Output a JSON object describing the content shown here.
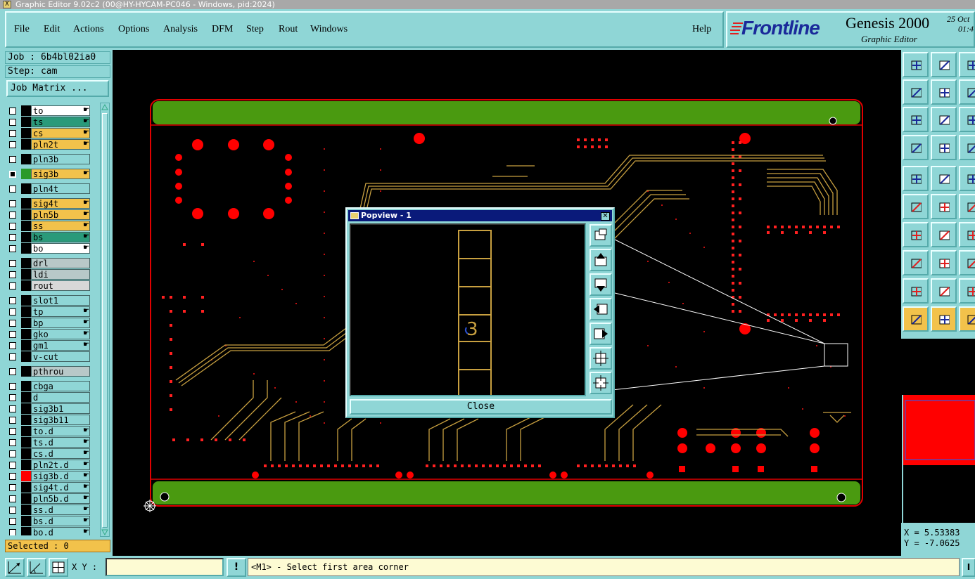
{
  "window": {
    "title": "Graphic Editor 9.02c2 (00@HY-HYCAM-PC046 - Windows, pid:2024)"
  },
  "menu": {
    "file": "File",
    "edit": "Edit",
    "actions": "Actions",
    "options": "Options",
    "analysis": "Analysis",
    "dfm": "DFM",
    "step": "Step",
    "rout": "Rout",
    "windows": "Windows",
    "help": "Help"
  },
  "brand": {
    "logo": "Frontline",
    "product": "Genesis 2000",
    "subtitle": "Graphic Editor",
    "date_line1": "25 Oct",
    "date_line2": "01:4"
  },
  "job": {
    "job_label": "Job : 6b4bl02ia0",
    "step_label": "Step: cam",
    "matrix_button": "Job Matrix ..."
  },
  "layers": [
    {
      "name": "to",
      "color": "#ffffff",
      "swatch": "#000000",
      "hand": true
    },
    {
      "name": "ts",
      "color": "#2a9a7a",
      "swatch": "#000000",
      "hand": true
    },
    {
      "name": "cs",
      "color": "#f2c24b",
      "swatch": "#000000",
      "hand": true
    },
    {
      "name": "pln2t",
      "color": "#f2c24b",
      "swatch": "#000000",
      "hand": true
    },
    {
      "name": "pln3b",
      "color": "#8fd6d6",
      "swatch": "#000000",
      "hand": false
    },
    {
      "name": "sig3b",
      "color": "#f2c24b",
      "swatch": "#2a9a2a",
      "hand": true,
      "active": true
    },
    {
      "name": "pln4t",
      "color": "#8fd6d6",
      "swatch": "#000000",
      "hand": false
    },
    {
      "name": "sig4t",
      "color": "#f2c24b",
      "swatch": "#000000",
      "hand": true
    },
    {
      "name": "pln5b",
      "color": "#f2c24b",
      "swatch": "#000000",
      "hand": true
    },
    {
      "name": "ss",
      "color": "#f2c24b",
      "swatch": "#000000",
      "hand": true
    },
    {
      "name": "bs",
      "color": "#2a9a7a",
      "swatch": "#000000",
      "hand": true
    },
    {
      "name": "bo",
      "color": "#ffffff",
      "swatch": "#000000",
      "hand": true
    },
    {
      "name": "drl",
      "color": "#b8c8c8",
      "swatch": "#000000",
      "hand": false
    },
    {
      "name": "ldi",
      "color": "#b8c8c8",
      "swatch": "#000000",
      "hand": false
    },
    {
      "name": "rout",
      "color": "#d8d8d8",
      "swatch": "#000000",
      "hand": false
    },
    {
      "name": "slot1",
      "color": "#8fd6d6",
      "swatch": "#000000",
      "hand": false
    },
    {
      "name": "tp",
      "color": "#8fd6d6",
      "swatch": "#000000",
      "hand": true
    },
    {
      "name": "bp",
      "color": "#8fd6d6",
      "swatch": "#000000",
      "hand": true
    },
    {
      "name": "gko",
      "color": "#8fd6d6",
      "swatch": "#000000",
      "hand": true
    },
    {
      "name": "gm1",
      "color": "#8fd6d6",
      "swatch": "#000000",
      "hand": true
    },
    {
      "name": "v-cut",
      "color": "#8fd6d6",
      "swatch": "#000000",
      "hand": false
    },
    {
      "name": "pthrou",
      "color": "#b8c8c8",
      "swatch": "#000000",
      "hand": false
    },
    {
      "name": "cbga",
      "color": "#8fd6d6",
      "swatch": "#000000",
      "hand": false
    },
    {
      "name": "d",
      "color": "#8fd6d6",
      "swatch": "#000000",
      "hand": false
    },
    {
      "name": "sig3b1",
      "color": "#8fd6d6",
      "swatch": "#000000",
      "hand": false
    },
    {
      "name": "sig3b11",
      "color": "#8fd6d6",
      "swatch": "#000000",
      "hand": false
    },
    {
      "name": "to.d",
      "color": "#8fd6d6",
      "swatch": "#000000",
      "hand": true
    },
    {
      "name": "ts.d",
      "color": "#8fd6d6",
      "swatch": "#000000",
      "hand": true
    },
    {
      "name": "cs.d",
      "color": "#8fd6d6",
      "swatch": "#000000",
      "hand": true
    },
    {
      "name": "pln2t.d",
      "color": "#8fd6d6",
      "swatch": "#000000",
      "hand": true
    },
    {
      "name": "sig3b.d",
      "color": "#8fd6d6",
      "swatch": "#ff0000",
      "hand": true
    },
    {
      "name": "sig4t.d",
      "color": "#8fd6d6",
      "swatch": "#000000",
      "hand": true
    },
    {
      "name": "pln5b.d",
      "color": "#8fd6d6",
      "swatch": "#000000",
      "hand": true
    },
    {
      "name": "ss.d",
      "color": "#8fd6d6",
      "swatch": "#000000",
      "hand": true
    },
    {
      "name": "bs.d",
      "color": "#8fd6d6",
      "swatch": "#000000",
      "hand": true
    },
    {
      "name": "bo.d",
      "color": "#8fd6d6",
      "swatch": "#000000",
      "hand": true
    }
  ],
  "selected": "Selected : 0",
  "popview": {
    "title": "Popview - 1",
    "close": "Close",
    "zoom_glyph": "3"
  },
  "coords": {
    "x": "X = 5.53383",
    "y": "Y = -7.0625"
  },
  "status": {
    "xy_label": "X Y :",
    "xy_value": "",
    "message": "<M1> - Select first area corner",
    "bang": "!"
  },
  "colors": {
    "panel": "#8fd6d6",
    "board_green": "#4a9a10",
    "pad_red": "#ff0000",
    "trace_gold": "#c8a040",
    "outline_red": "#e00000"
  }
}
